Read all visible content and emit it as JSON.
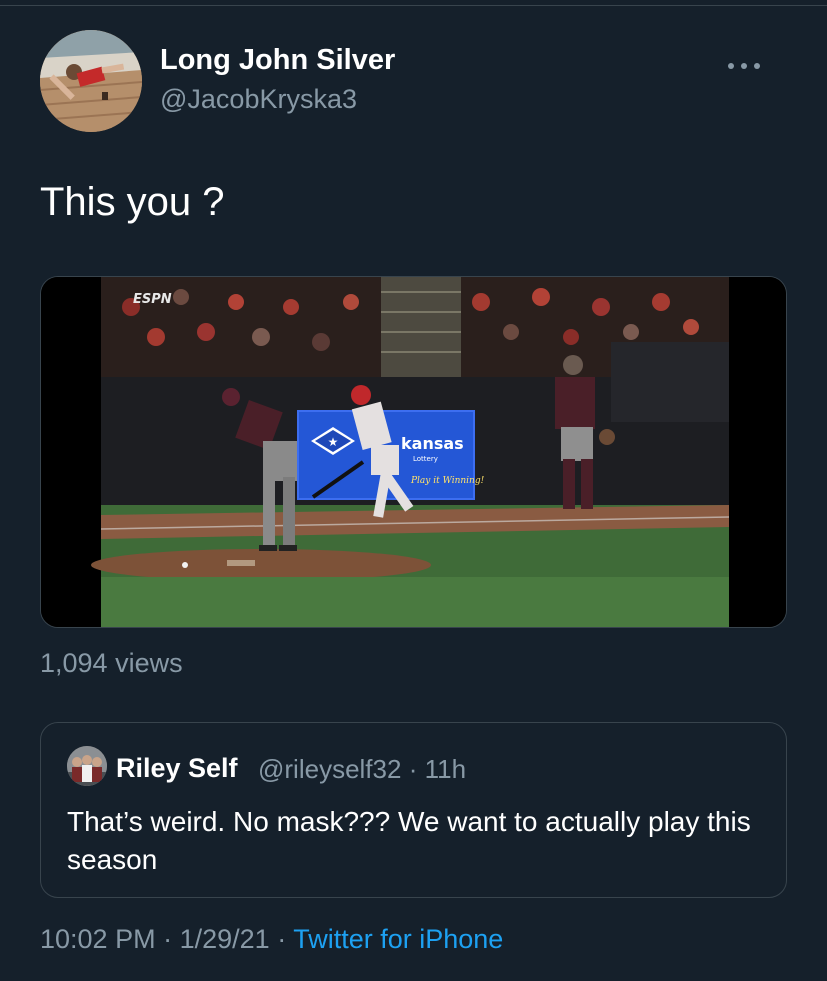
{
  "tweet": {
    "display_name": "Long John Silver",
    "handle": "@JacobKryska3",
    "text": "This you ?",
    "views": "1,094 views",
    "time": "10:02 PM",
    "date": "1/29/21",
    "separator": "·",
    "source": "Twitter for iPhone"
  },
  "media": {
    "broadcaster": "ESPN",
    "banner_text": "kansas",
    "banner_sub": "Lottery",
    "banner_slogan": "Play it Winning!"
  },
  "quote": {
    "display_name": "Riley Self",
    "handle": "@rileyself32",
    "separator": "·",
    "age": "11h",
    "text": "That’s weird. No mask??? We want to actually play this season"
  },
  "icons": {
    "more": "more-horizontal-icon"
  },
  "colors": {
    "background": "#15202b",
    "secondary_text": "#8899a6",
    "link": "#1da1f2",
    "border": "#38444d"
  }
}
